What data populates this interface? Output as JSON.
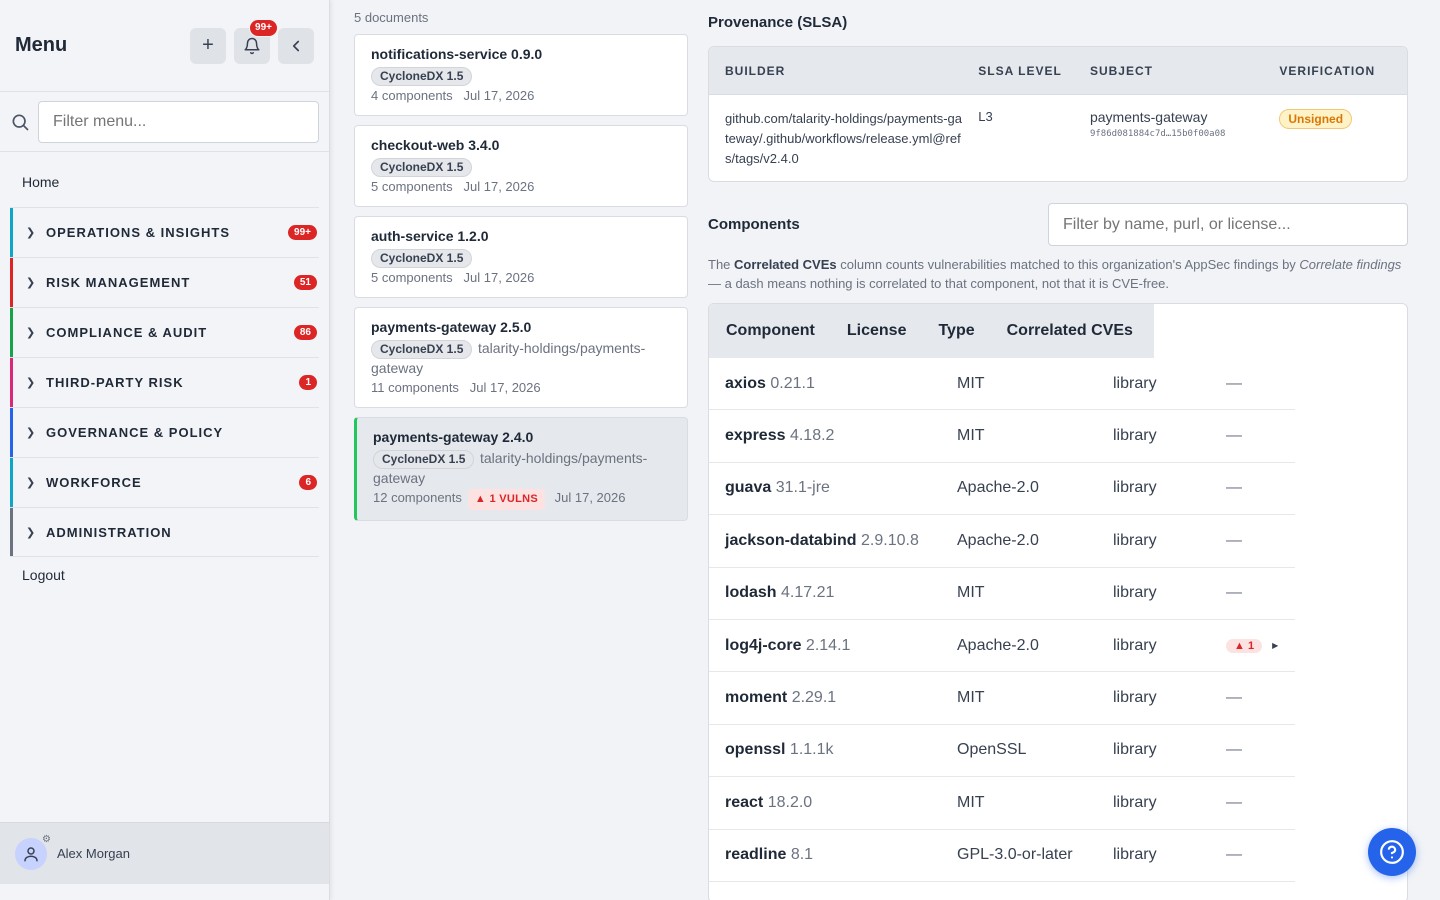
{
  "sidebar": {
    "title": "Menu",
    "notif_count": "99+",
    "search_placeholder": "Filter menu...",
    "home": "Home",
    "items": [
      {
        "label": "OPERATIONS & INSIGHTS",
        "count": "99+",
        "color": "#0ea5c6"
      },
      {
        "label": "RISK MANAGEMENT",
        "count": "51",
        "color": "#dc2626"
      },
      {
        "label": "COMPLIANCE & AUDIT",
        "count": "86",
        "color": "#16a34a"
      },
      {
        "label": "THIRD-PARTY RISK",
        "count": "1",
        "color": "#db2777"
      },
      {
        "label": "GOVERNANCE & POLICY",
        "count": "",
        "color": "#2563eb"
      },
      {
        "label": "WORKFORCE",
        "count": "6",
        "color": "#0ea5c6"
      },
      {
        "label": "ADMINISTRATION",
        "count": "",
        "color": "#6b7280"
      }
    ],
    "logout": "Logout",
    "user_name": "Alex Morgan"
  },
  "documents": {
    "count_label": "5 documents",
    "items": [
      {
        "title": "notifications-service 0.9.0",
        "format": "CycloneDX 1.5",
        "repo": "",
        "components": "4 components",
        "vulns": "",
        "date": "Jul 17, 2026"
      },
      {
        "title": "checkout-web 3.4.0",
        "format": "CycloneDX 1.5",
        "repo": "",
        "components": "5 components",
        "vulns": "",
        "date": "Jul 17, 2026"
      },
      {
        "title": "auth-service 1.2.0",
        "format": "CycloneDX 1.5",
        "repo": "",
        "components": "5 components",
        "vulns": "",
        "date": "Jul 17, 2026"
      },
      {
        "title": "payments-gateway 2.5.0",
        "format": "CycloneDX 1.5",
        "repo": "talarity-holdings/payments-gateway",
        "components": "11 components",
        "vulns": "",
        "date": "Jul 17, 2026"
      },
      {
        "title": "payments-gateway 2.4.0",
        "format": "CycloneDX 1.5",
        "repo": "talarity-holdings/payments-gateway",
        "components": "12 components",
        "vulns": "▲ 1 VULNS",
        "date": "Jul 17, 2026"
      }
    ]
  },
  "provenance": {
    "title": "Provenance (SLSA)",
    "headers": [
      "BUILDER",
      "SLSA LEVEL",
      "SUBJECT",
      "VERIFICATION"
    ],
    "builder": "github.com/talarity-holdings/payments-gateway/.github/workflows/release.yml@refs/tags/v2.4.0",
    "level": "L3",
    "subject": "payments-gateway",
    "subject_hash": "9f86d081884c7d…15b0f00a08",
    "verification": "Unsigned"
  },
  "components": {
    "title": "Components",
    "filter_placeholder": "Filter by name, purl, or license...",
    "note_pre": "The ",
    "note_bold": "Correlated CVEs",
    "note_mid": " column counts vulnerabilities matched to this organization's AppSec findings by ",
    "note_italic": "Correlate findings",
    "note_post": " — a dash means nothing is correlated to that component, not that it is CVE-free.",
    "headers": [
      "Component",
      "License",
      "Type",
      "Correlated CVEs"
    ],
    "rows": [
      {
        "name": "axios",
        "version": "0.21.1",
        "license": "MIT",
        "type": "library",
        "cves": "—"
      },
      {
        "name": "express",
        "version": "4.18.2",
        "license": "MIT",
        "type": "library",
        "cves": "—"
      },
      {
        "name": "guava",
        "version": "31.1-jre",
        "license": "Apache-2.0",
        "type": "library",
        "cves": "—"
      },
      {
        "name": "jackson-databind",
        "version": "2.9.10.8",
        "license": "Apache-2.0",
        "type": "library",
        "cves": "—"
      },
      {
        "name": "lodash",
        "version": "4.17.21",
        "license": "MIT",
        "type": "library",
        "cves": "—"
      },
      {
        "name": "log4j-core",
        "version": "2.14.1",
        "license": "Apache-2.0",
        "type": "library",
        "cves": "▲ 1"
      },
      {
        "name": "moment",
        "version": "2.29.1",
        "license": "MIT",
        "type": "library",
        "cves": "—"
      },
      {
        "name": "openssl",
        "version": "1.1.1k",
        "license": "OpenSSL",
        "type": "library",
        "cves": "—"
      },
      {
        "name": "react",
        "version": "18.2.0",
        "license": "MIT",
        "type": "library",
        "cves": "—"
      },
      {
        "name": "readline",
        "version": "8.1",
        "license": "GPL-3.0-or-later",
        "type": "library",
        "cves": "—"
      }
    ]
  }
}
